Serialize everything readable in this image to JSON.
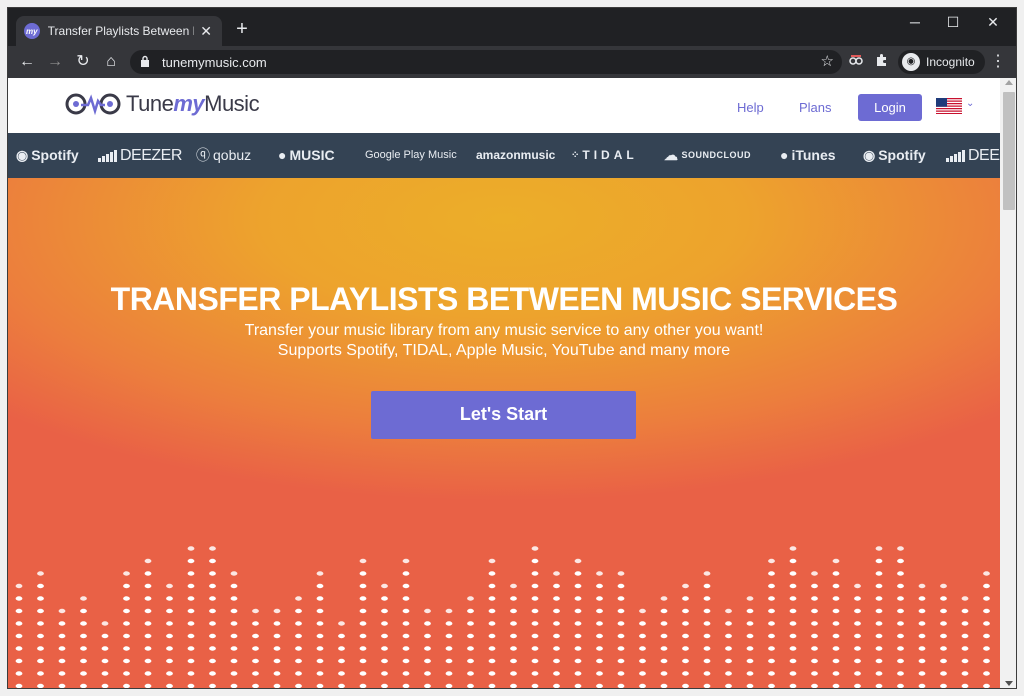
{
  "browser": {
    "tab_title": "Transfer Playlists Between Music",
    "tab_favicon_text": "my",
    "tab_close": "✕",
    "new_tab": "+",
    "url": "tunemymusic.com",
    "profile_label": "Incognito",
    "window_controls": {
      "minimize": "─",
      "maximize": "☐",
      "close": "✕"
    },
    "icons": [
      "back-arrow-icon",
      "forward-arrow-icon",
      "reload-icon",
      "home-icon",
      "lock-icon",
      "star-icon",
      "extension-icon",
      "puzzle-icon",
      "incognito-icon",
      "kebab-menu-icon"
    ]
  },
  "site": {
    "logo": {
      "pre": "Tune",
      "my": "my",
      "post": "Music"
    },
    "nav": {
      "help": "Help",
      "plans": "Plans",
      "login": "Login"
    },
    "colors": {
      "accent": "#6d6bd3",
      "strip": "#344354",
      "hero_top": "#ecae29",
      "hero_bottom": "#e96146"
    }
  },
  "services": [
    {
      "label": "Spotify"
    },
    {
      "label": "DEEZER"
    },
    {
      "label": "qobuz"
    },
    {
      "label": "MUSIC"
    },
    {
      "label": "Google Play Music"
    },
    {
      "label": "amazonmusic"
    },
    {
      "label": "TIDAL"
    },
    {
      "label": "SOUNDCLOUD"
    },
    {
      "label": "iTunes"
    },
    {
      "label": "Spotify"
    },
    {
      "label": "DEE"
    }
  ],
  "hero": {
    "title": "TRANSFER PLAYLISTS BETWEEN MUSIC SERVICES",
    "subtitle_line1": "Transfer your music library from any music service to any other you want!",
    "subtitle_line2": "Supports Spotify, TIDAL, Apple Music, YouTube and many more",
    "cta": "Let's Start"
  }
}
